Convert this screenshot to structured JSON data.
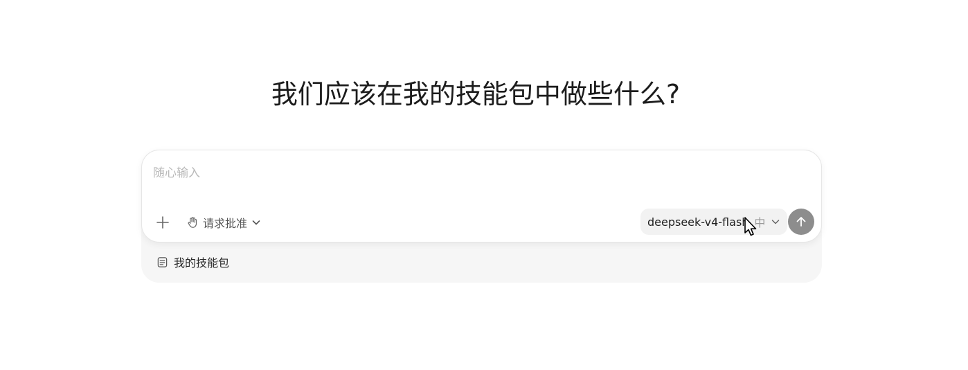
{
  "heading": "我们应该在我的技能包中做些什么?",
  "composer": {
    "placeholder": "随心输入",
    "value": "",
    "add_icon": "plus-icon",
    "approval": {
      "icon": "hand-icon",
      "label": "请求批准",
      "dropdown_icon": "chevron-down-icon"
    },
    "model": {
      "name": "deepseek-v4-flash",
      "effort": "中",
      "dropdown_icon": "chevron-down-icon"
    },
    "send_icon": "arrow-up-icon"
  },
  "project": {
    "icon": "document-icon",
    "label": "我的技能包"
  },
  "colors": {
    "send_button": "#8d8d8d",
    "pill_bg": "#f2f2f2",
    "shell_bg": "#f6f6f6"
  }
}
